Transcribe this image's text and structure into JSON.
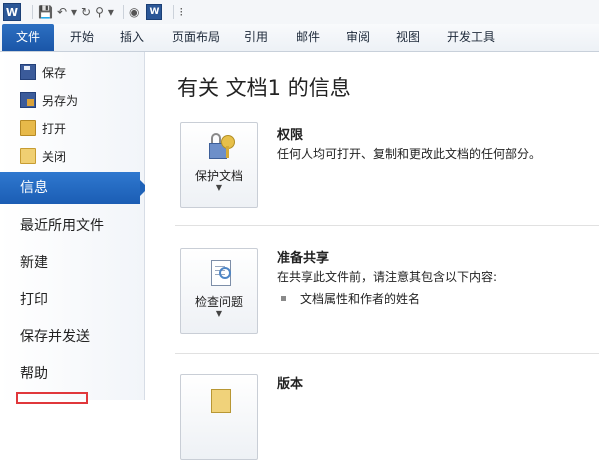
{
  "quick_access": {
    "app_icon": "word-app-icon",
    "logo_letter": "W",
    "items": [
      {
        "name": "save-icon",
        "glyph": "💾"
      },
      {
        "name": "undo-icon",
        "glyph": "↶"
      },
      {
        "name": "dropdown-icon",
        "glyph": "▾"
      },
      {
        "name": "redo-icon",
        "glyph": "↻"
      },
      {
        "name": "format-painter-icon",
        "glyph": "⚲"
      },
      {
        "name": "dropdown-icon",
        "glyph": "▾"
      },
      {
        "name": "spell-icon",
        "glyph": "◉"
      },
      {
        "name": "word-icon",
        "glyph": "W"
      },
      {
        "name": "customize-icon",
        "glyph": "⁝"
      }
    ]
  },
  "ribbon": {
    "tabs": [
      "文件",
      "开始",
      "插入",
      "页面布局",
      "引用",
      "邮件",
      "审阅",
      "视图",
      "开发工具"
    ],
    "active_color": "#1f5fb4"
  },
  "backstage": {
    "commands": [
      "保存",
      "另存为",
      "打开",
      "关闭"
    ],
    "nav": [
      "信息",
      "最近所用文件",
      "新建",
      "打印",
      "保存并发送",
      "帮助"
    ],
    "active_nav": "信息"
  },
  "main": {
    "title": "有关 文档1 的信息",
    "sections": [
      {
        "button_label": "保护文档",
        "title": "权限",
        "description": "任何人均可打开、复制和更改此文档的任何部分。"
      },
      {
        "button_label": "检查问题",
        "title": "准备共享",
        "description": "在共享此文件前，请注意其包含以下内容:",
        "bullets": [
          "文档属性和作者的姓名"
        ]
      },
      {
        "title": "版本"
      }
    ]
  }
}
